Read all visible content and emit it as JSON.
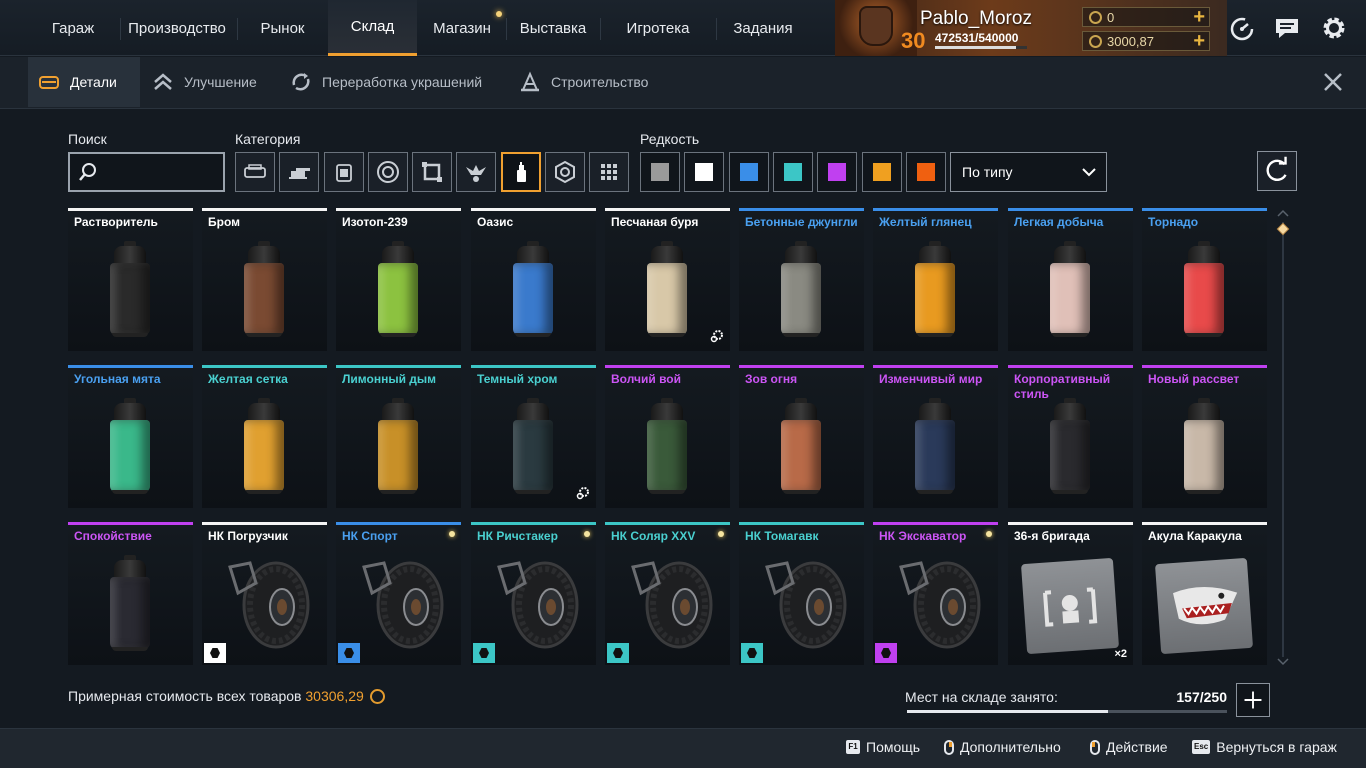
{
  "nav": {
    "tabs": [
      {
        "label": "Гараж"
      },
      {
        "label": "Производство"
      },
      {
        "label": "Рынок"
      },
      {
        "label": "Склад"
      },
      {
        "label": "Магазин"
      },
      {
        "label": "Выставка"
      },
      {
        "label": "Игротека"
      },
      {
        "label": "Задания"
      }
    ],
    "active_tab": "Склад"
  },
  "profile": {
    "name": "Pablo_Moroz",
    "level": "30",
    "xp": "472531/540000",
    "xp_fraction": 0.875,
    "currency1": "0",
    "currency2": "3000,87"
  },
  "subnav": {
    "tabs": [
      {
        "label": "Детали",
        "icon": "parts-icon"
      },
      {
        "label": "Улучшение",
        "icon": "upgrade-chevrons-icon"
      },
      {
        "label": "Переработка украшений",
        "icon": "recycle-icon"
      },
      {
        "label": "Строительство",
        "icon": "construction-icon"
      }
    ],
    "active": "Детали"
  },
  "filters": {
    "search_label": "Поиск",
    "search_value": "",
    "category_label": "Категория",
    "categories": [
      "cabin-icon",
      "weapon-icon",
      "module-icon",
      "wheel-icon",
      "frame-icon",
      "decor-icon",
      "paint-icon",
      "rim-icon",
      "grid-icon"
    ],
    "active_category": "paint-icon",
    "rarity_label": "Редкость",
    "rarities": [
      "#9a9a9a",
      "#ffffff",
      "#3a8ee8",
      "#3cc6c6",
      "#c040f0",
      "#f0a020",
      "#f06010"
    ],
    "sort_value": "По типу"
  },
  "items": [
    {
      "name": "Растворитель",
      "rarity": "white",
      "kind": "can",
      "color": "#2a2a2a"
    },
    {
      "name": "Бром",
      "rarity": "white",
      "kind": "can",
      "color": "#7a4a32"
    },
    {
      "name": "Изотоп-239",
      "rarity": "white",
      "kind": "can",
      "color": "#8cc240"
    },
    {
      "name": "Оазис",
      "rarity": "white",
      "kind": "can",
      "color": "#3a7acc"
    },
    {
      "name": "Песчаная буря",
      "rarity": "white",
      "kind": "can",
      "color": "#d8c8a8",
      "gear": true
    },
    {
      "name": "Бетонные джунгли",
      "rarity": "blue",
      "kind": "can",
      "color": "#8a8a82"
    },
    {
      "name": "Желтый глянец",
      "rarity": "blue",
      "kind": "can",
      "color": "#e89a20"
    },
    {
      "name": "Легкая добыча",
      "rarity": "blue",
      "kind": "can",
      "color": "#e0c0b8"
    },
    {
      "name": "Торнадо",
      "rarity": "blue",
      "kind": "can",
      "color": "#e84a4a"
    },
    {
      "name": "Угольная мята",
      "rarity": "blue",
      "kind": "can",
      "color": "#3ab88a"
    },
    {
      "name": "Желтая сетка",
      "rarity": "teal",
      "kind": "can",
      "color": "#e0a030"
    },
    {
      "name": "Лимонный дым",
      "rarity": "teal",
      "kind": "can",
      "color": "#c89028"
    },
    {
      "name": "Темный хром",
      "rarity": "teal",
      "kind": "can",
      "color": "#2a3a40",
      "gear": true
    },
    {
      "name": "Волчий вой",
      "rarity": "purple",
      "kind": "can",
      "color": "#3a5a3a"
    },
    {
      "name": "Зов огня",
      "rarity": "purple",
      "kind": "can",
      "color": "#b86a48"
    },
    {
      "name": "Изменчивый мир",
      "rarity": "purple",
      "kind": "can",
      "color": "#2a3a5a"
    },
    {
      "name": "Корпоративный стиль",
      "rarity": "purple",
      "kind": "can",
      "color": "#2a2a2e"
    },
    {
      "name": "Новый рассвет",
      "rarity": "purple",
      "kind": "can",
      "color": "#c8b8a8"
    },
    {
      "name": "Спокойствие",
      "rarity": "purple",
      "kind": "can",
      "color": "#2a2a32"
    },
    {
      "name": "НК Погрузчик",
      "rarity": "white",
      "kind": "wheel",
      "tag": "#ffffff"
    },
    {
      "name": "НК Спорт",
      "rarity": "blue",
      "kind": "wheel",
      "tag": "#3a8ee8",
      "spark": true
    },
    {
      "name": "НК Ричстакер",
      "rarity": "teal",
      "kind": "wheel",
      "tag": "#3cc6c6",
      "spark": true
    },
    {
      "name": "НК Соляр XXV",
      "rarity": "teal",
      "kind": "wheel",
      "tag": "#3cc6c6",
      "spark": true
    },
    {
      "name": "НК Томагавк",
      "rarity": "teal",
      "kind": "wheel",
      "tag": "#3cc6c6"
    },
    {
      "name": "НК Экскаватор",
      "rarity": "purple",
      "kind": "wheel",
      "tag": "#c040f0",
      "spark": true
    },
    {
      "name": "36-я бригада",
      "rarity": "white",
      "kind": "decal",
      "count": "×2"
    },
    {
      "name": "Акула Каракула",
      "rarity": "white",
      "kind": "decal-shark"
    }
  ],
  "footer": {
    "total_label": "Примерная стоимость всех товаров",
    "total_value": "30306,29",
    "storage_label": "Мест на складе занято:",
    "storage_value": "157/250",
    "storage_fraction": 0.628
  },
  "hints": [
    {
      "key": "F1",
      "label": "Помощь"
    },
    {
      "key": "mouse-right",
      "label": "Дополнительно"
    },
    {
      "key": "mouse-left",
      "label": "Действие"
    },
    {
      "key": "Esc",
      "label": "Вернуться в гараж"
    }
  ]
}
